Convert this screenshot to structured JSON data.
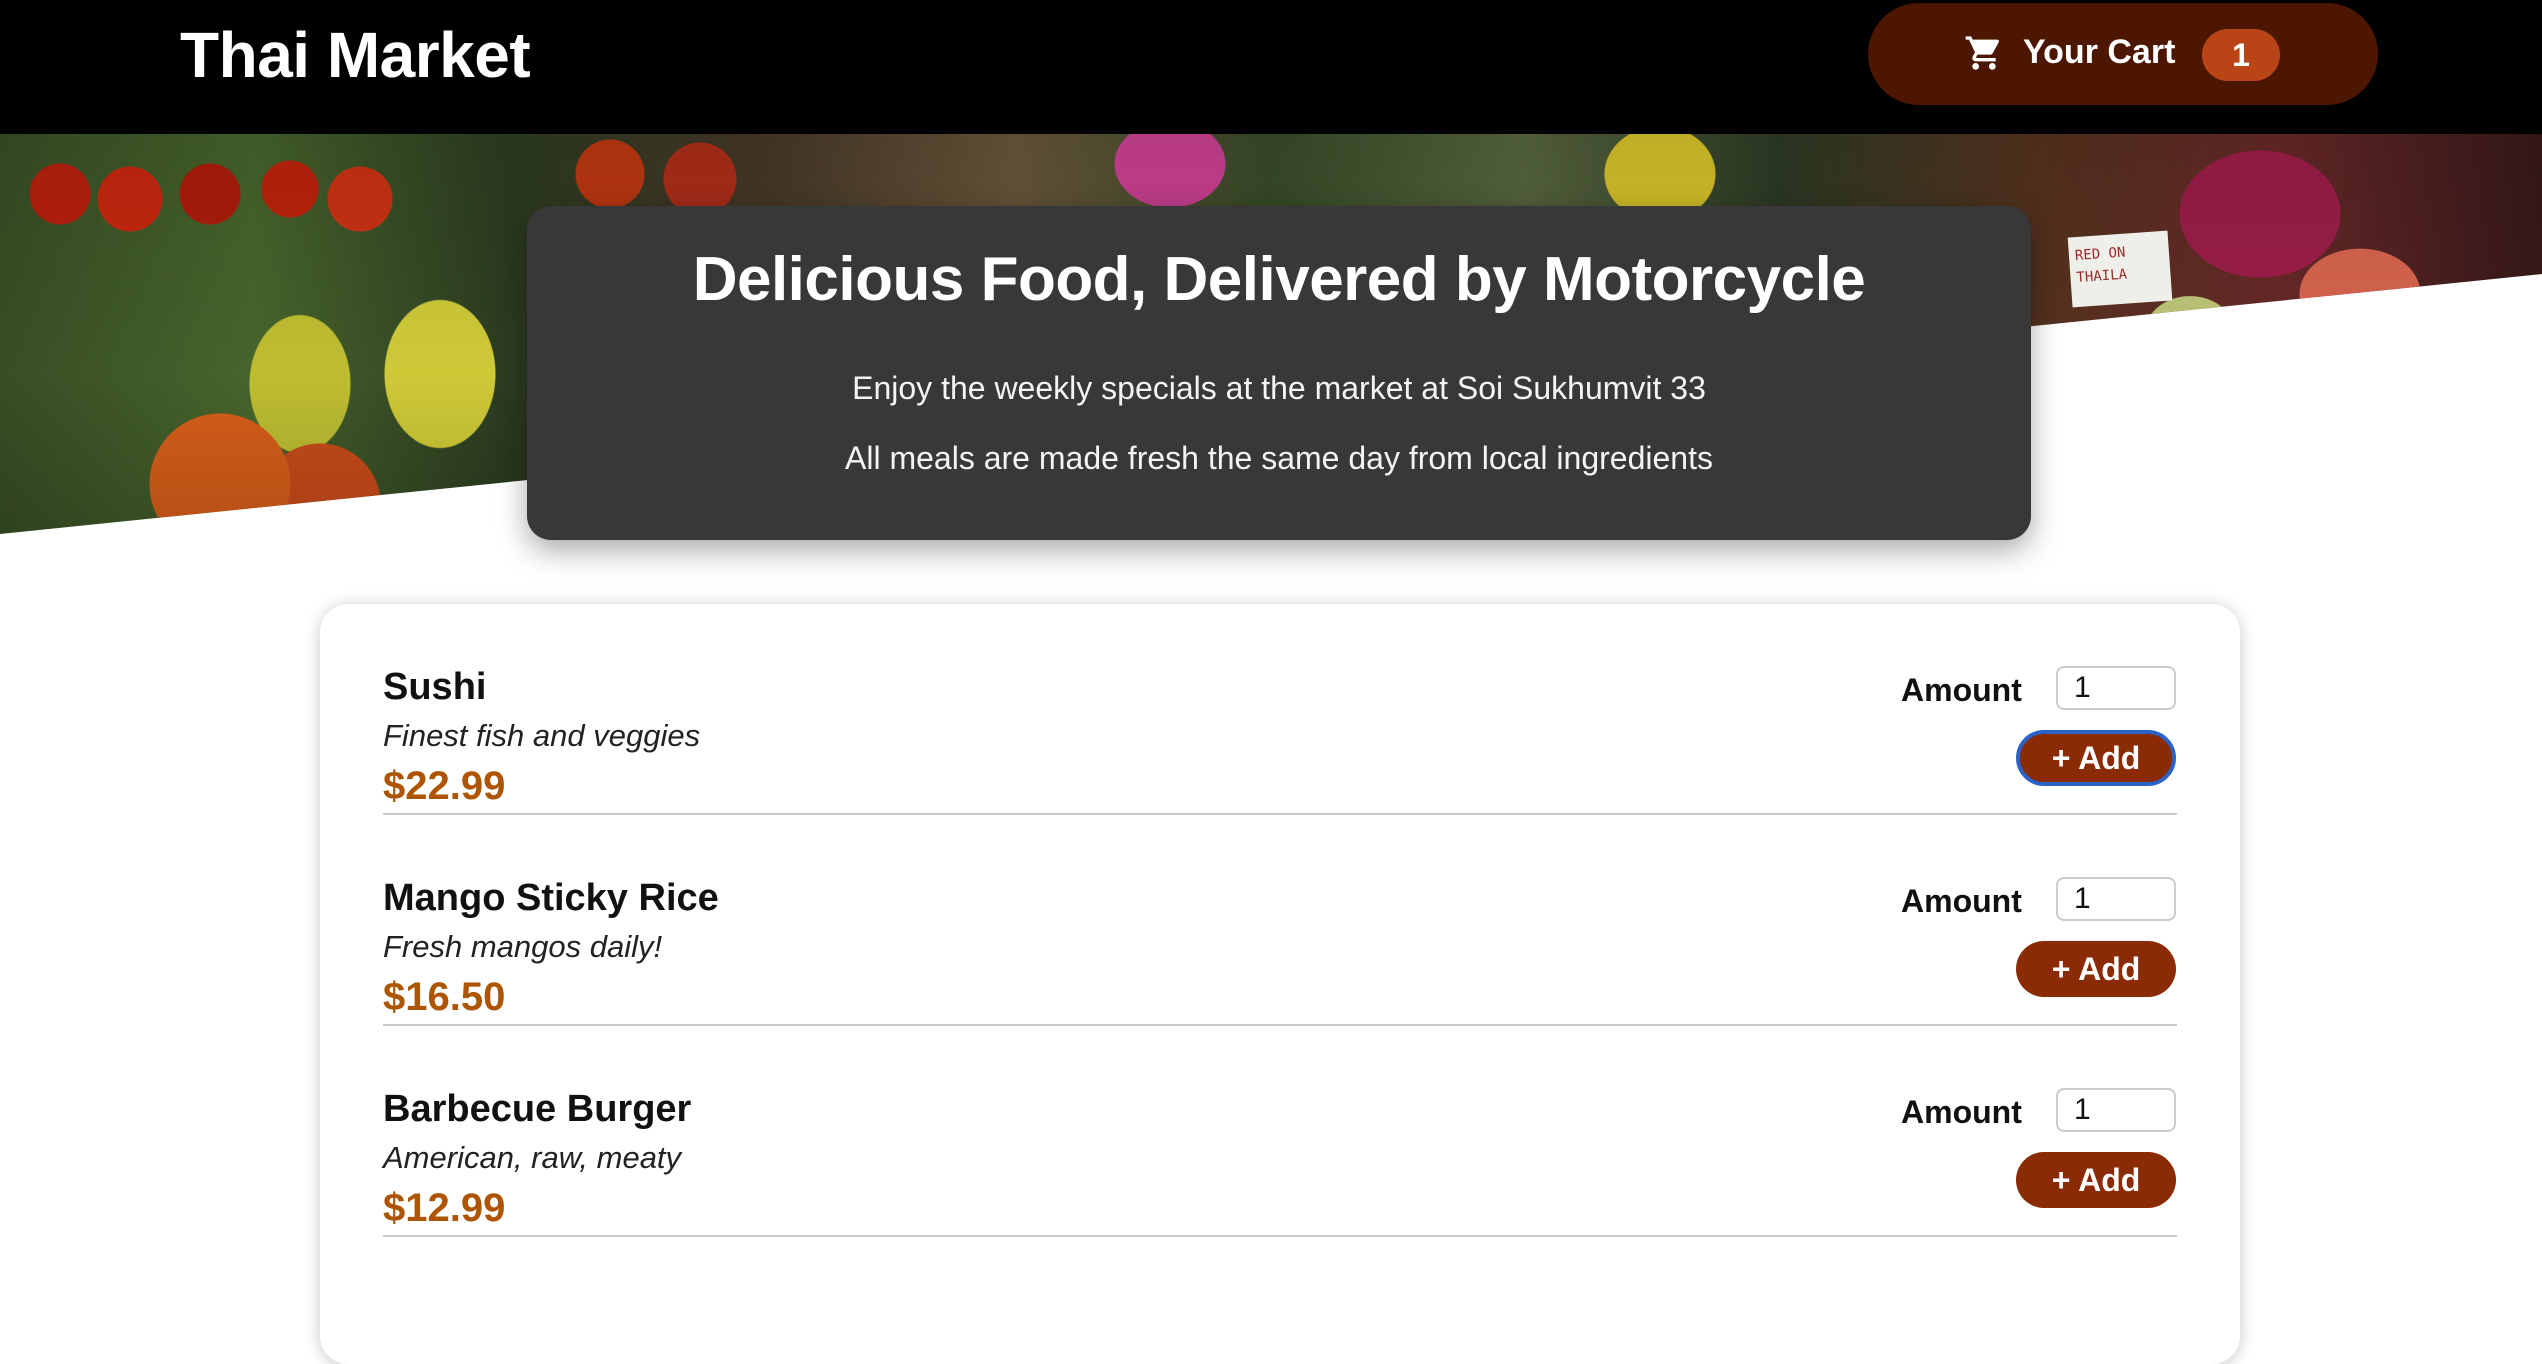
{
  "header": {
    "title": "Thai Market",
    "cart": {
      "icon": "shopping-cart-icon",
      "label": "Your Cart",
      "count": "1"
    }
  },
  "hero": {
    "image": "market-produce-photo",
    "sign_text": [
      "RED ON",
      "THAILA"
    ]
  },
  "summary": {
    "title": "Delicious Food, Delivered by Motorcycle",
    "line1": "Enjoy the weekly specials at the market at Soi Sukhumvit 33",
    "line2": "All meals are made fresh the same day from local ingredients"
  },
  "meals": [
    {
      "name": "Sushi",
      "description": "Finest fish and veggies",
      "price": "$22.99",
      "amount_label": "Amount",
      "amount": "1",
      "add_label": "+ Add",
      "focused": true
    },
    {
      "name": "Mango Sticky Rice",
      "description": "Fresh mangos daily!",
      "price": "$16.50",
      "amount_label": "Amount",
      "amount": "1",
      "add_label": "+ Add",
      "focused": false
    },
    {
      "name": "Barbecue Burger",
      "description": "American, raw, meaty",
      "price": "$12.99",
      "amount_label": "Amount",
      "amount": "1",
      "add_label": "+ Add",
      "focused": false
    }
  ],
  "colors": {
    "header_bg": "#000000",
    "cart_bg": "#4d1601",
    "badge_bg": "#b94517",
    "summary_bg": "#383838",
    "price": "#ad5502",
    "add_button": "#8a2b06",
    "focus_ring": "#2b62c6"
  }
}
